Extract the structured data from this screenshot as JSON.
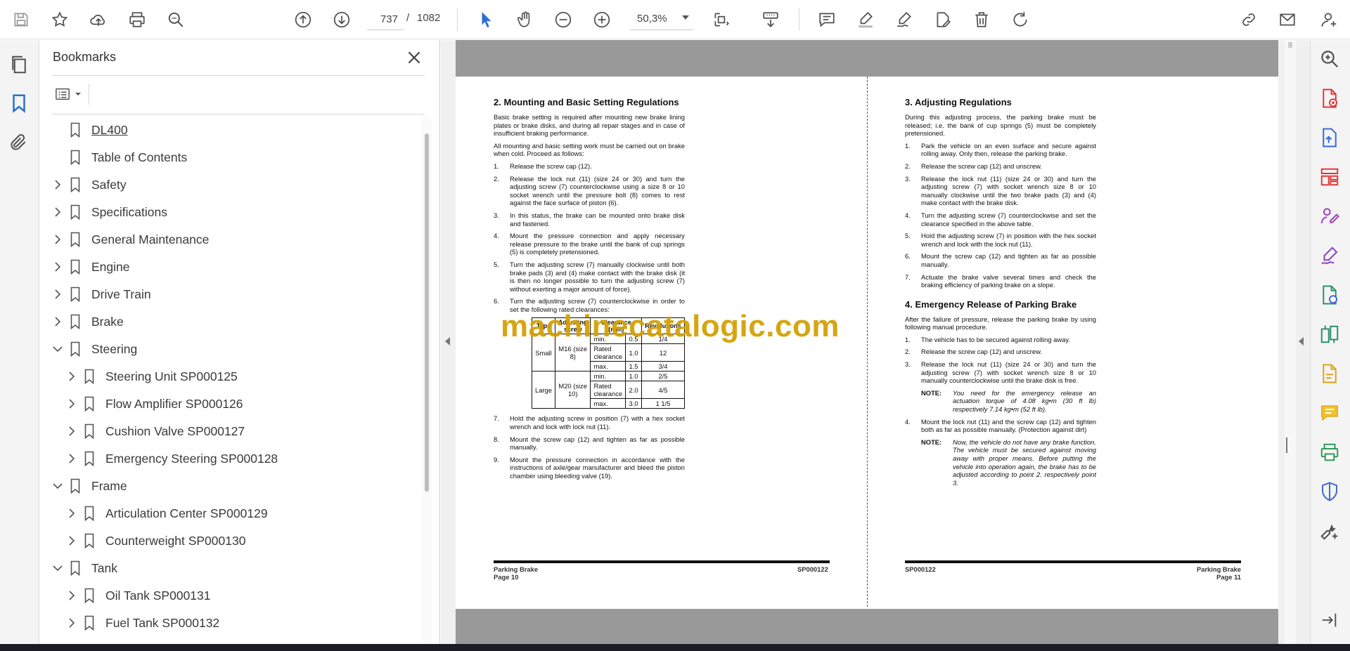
{
  "toolbar": {
    "page_current": "737",
    "page_sep": "/",
    "page_total": "1082",
    "zoom": "50,3%",
    "colors": {
      "active_tool": "#2b6fd4"
    },
    "icons": [
      "save-icon",
      "bookmark-star-icon",
      "upload-icon",
      "print-icon",
      "find-icon",
      "page-up-icon",
      "page-down-icon",
      "select-cursor-icon",
      "hand-icon",
      "zoom-out-icon",
      "zoom-in-icon",
      "fit-page-icon",
      "scroll-mode-icon",
      "comment-icon",
      "highlight-icon",
      "sign-icon",
      "edit-page-icon",
      "delete-icon",
      "rotate-icon",
      "share-link-icon",
      "email-icon",
      "account-icon"
    ]
  },
  "bookmarks": {
    "title": "Bookmarks",
    "items": [
      {
        "label": "DL400",
        "level": 0,
        "expand": "none"
      },
      {
        "label": "Table of Contents",
        "level": 0,
        "expand": "none"
      },
      {
        "label": "Safety",
        "level": 0,
        "expand": "collapsed"
      },
      {
        "label": "Specifications",
        "level": 0,
        "expand": "collapsed"
      },
      {
        "label": "General Maintenance",
        "level": 0,
        "expand": "collapsed"
      },
      {
        "label": "Engine",
        "level": 0,
        "expand": "collapsed"
      },
      {
        "label": "Drive Train",
        "level": 0,
        "expand": "collapsed"
      },
      {
        "label": "Brake",
        "level": 0,
        "expand": "collapsed"
      },
      {
        "label": "Steering",
        "level": 0,
        "expand": "expanded"
      },
      {
        "label": "Steering Unit SP000125",
        "level": 1,
        "expand": "collapsed"
      },
      {
        "label": "Flow Amplifier SP000126",
        "level": 1,
        "expand": "collapsed"
      },
      {
        "label": "Cushion Valve SP000127",
        "level": 1,
        "expand": "collapsed"
      },
      {
        "label": "Emergency Steering SP000128",
        "level": 1,
        "expand": "collapsed"
      },
      {
        "label": "Frame",
        "level": 0,
        "expand": "expanded"
      },
      {
        "label": "Articulation Center SP000129",
        "level": 1,
        "expand": "collapsed"
      },
      {
        "label": "Counterweight SP000130",
        "level": 1,
        "expand": "collapsed"
      },
      {
        "label": "Tank",
        "level": 0,
        "expand": "expanded"
      },
      {
        "label": "Oil Tank SP000131",
        "level": 1,
        "expand": "collapsed"
      },
      {
        "label": "Fuel Tank SP000132",
        "level": 1,
        "expand": "collapsed"
      }
    ]
  },
  "left_page": {
    "heading": "2. Mounting and Basic Setting Regulations",
    "para1": "Basic brake setting is required after mounting new brake lining plates or brake disks, and during all repair stages and in case of insufficient braking performance.",
    "para2": "All mounting and basic setting work must be carried out on brake when cold. Proceed as follows:",
    "steps": [
      {
        "n": "1.",
        "t": "Release the screw cap (12)."
      },
      {
        "n": "2.",
        "t": "Release the lock nut (11) (size 24 or 30) and turn the adjusting screw (7) counterclockwise using a size 8 or 10 socket wrench until the pressure bolt (8) comes to rest against the face surface of piston (6)."
      },
      {
        "n": "3.",
        "t": "In this status, the brake can be mounted onto brake disk and fastened."
      },
      {
        "n": "4.",
        "t": "Mount the pressure connection and apply necessary release pressure to the brake until the bank of cup springs (5) is completely pretensioned."
      },
      {
        "n": "5.",
        "t": "Turn the adjusting screw (7) manually clockwise until both brake pads (3) and (4) make contact with the brake disk (it is then no longer possible to turn the adjusting screw (7) without exerting a major amount of force)."
      },
      {
        "n": "6.",
        "t": "Turn the adjusting screw (7) counterclockwise in order to set the following rated clearances:"
      }
    ],
    "table": {
      "headers": [
        "Type",
        "Adjusting screw",
        "Clearance (mm)",
        "Revolutions"
      ],
      "rows": [
        {
          "type": "Small",
          "screw": "M16 (size 8)",
          "sub": [
            [
              "min.",
              "0.5",
              "1/4"
            ],
            [
              "Rated clearance",
              "1.0",
              "12"
            ],
            [
              "max.",
              "1.5",
              "3/4"
            ]
          ]
        },
        {
          "type": "Large",
          "screw": "M20 (size 10)",
          "sub": [
            [
              "min.",
              "1.0",
              "2/5"
            ],
            [
              "Rated clearance",
              "2.0",
              "4/5"
            ],
            [
              "max.",
              "3.0",
              "1 1/5"
            ]
          ]
        }
      ]
    },
    "steps2": [
      {
        "n": "7.",
        "t": "Hold the adjusting screw in position (7) with a hex socket wrench and lock with lock nut (11)."
      },
      {
        "n": "8.",
        "t": "Mount the screw cap (12) and tighten as far as possible manually."
      },
      {
        "n": "9.",
        "t": "Mount the pressure connection in accordance with the instructions of axle/gear manufacturer and bleed the piston chamber using bleeding valve (19)."
      }
    ],
    "footer_left": "Parking Brake",
    "footer_left2": "Page 10",
    "footer_right": "SP000122"
  },
  "right_page": {
    "heading": "3. Adjusting Regulations",
    "para1": "During this adjusting process, the parking brake must be released; i.e. the bank of cup springs (5) must be completely pretensioned.",
    "steps": [
      {
        "n": "1.",
        "t": "Park the vehicle on an even surface and secure against rolling away. Only then, release the parking brake."
      },
      {
        "n": "2.",
        "t": "Release the screw cap (12) and unscrew."
      },
      {
        "n": "3.",
        "t": "Release the lock nut (11) (size 24 or 30) and turn the adjusting screw (7) with socket wrench size 8 or 10 manually clockwise until the two brake pads (3) and (4) make contact with the brake disk."
      },
      {
        "n": "4.",
        "t": "Turn the adjusting screw (7) counterclockwise and set the clearance specified in the above table."
      },
      {
        "n": "5.",
        "t": "Hold the adjusting screw (7) in position with the hex socket wrench and lock with the lock nut (11)."
      },
      {
        "n": "6.",
        "t": "Mount the screw cap (12) and tighten as far as possible manually."
      },
      {
        "n": "7.",
        "t": "Actuate the brake valve several times and check the braking efficiency of parking brake on a slope."
      }
    ],
    "heading2": "4. Emergency Release of Parking Brake",
    "para2": "After the failure of pressure, release the parking brake by using following manual procedure.",
    "steps2": [
      {
        "n": "1.",
        "t": "The vehicle has to be secured against rolling away."
      },
      {
        "n": "2.",
        "t": "Release the screw cap (12) and unscrew."
      },
      {
        "n": "3.",
        "t": "Release the lock nut (11) (size 24 or 30) and turn the adjusting screw (7) with socket wrench size 8 or 10 manually counterclockwise until the brake disk is free."
      }
    ],
    "note1_label": "NOTE:",
    "note1": "You need for the emergency release an actuation torque of 4.08 kg•m (30 ft lb) respectively 7.14 kg•m (52 ft lb).",
    "step4": {
      "n": "4.",
      "t": "Mount the lock nut (11) and the screw cap (12) and tighten both as far as possible manually. (Protection against dirt)"
    },
    "note2_label": "NOTE:",
    "note2": "Now, the vehicle do not have any brake function. The vehicle must be secured against moving away with proper means. Before putting the vehicle into operation again, the brake has to be adjusted according to point 2. respectively point 3.",
    "footer_left": "SP000122",
    "footer_right": "Parking Brake",
    "footer_right2": "Page 11"
  },
  "watermark": "machinecatalogic.com",
  "right_rail_icons": [
    "search-doc-icon",
    "export-pdf-icon",
    "create-pdf-icon",
    "organize-pages-icon",
    "fill-sign-icon",
    "edit-pdf-icon",
    "export-icon",
    "compare-icon",
    "scan-icon",
    "comment-icon",
    "print-production-icon",
    "protect-icon",
    "more-tools-icon",
    "expand-panel-icon"
  ]
}
